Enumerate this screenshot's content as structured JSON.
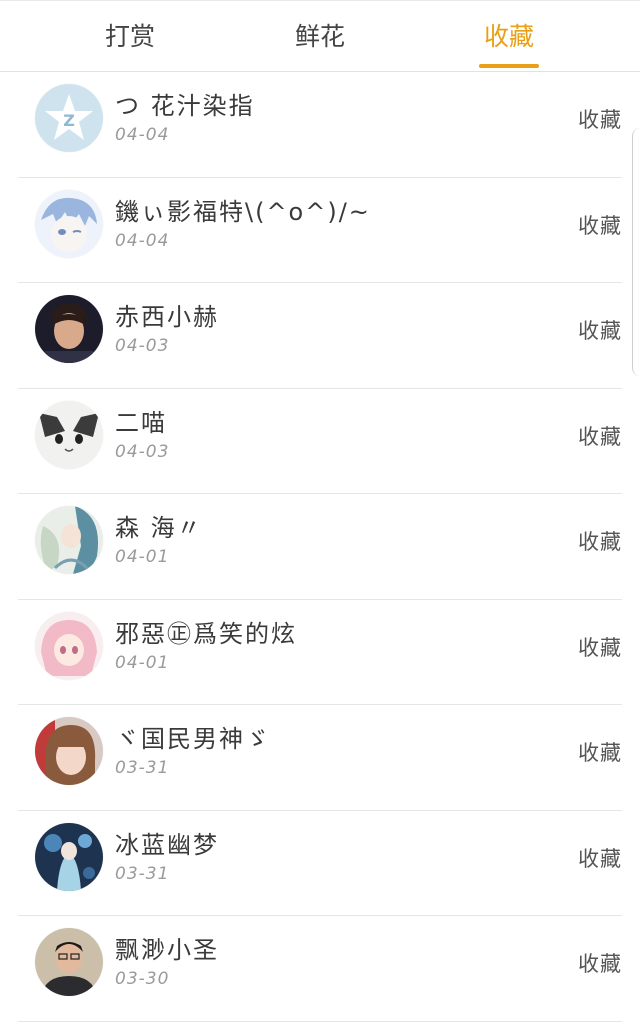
{
  "tabs": [
    {
      "label": "打赏",
      "active": false
    },
    {
      "label": "鲜花",
      "active": false
    },
    {
      "label": "收藏",
      "active": true
    }
  ],
  "accent_color": "#e8a018",
  "list": [
    {
      "name": "つ 花汁染指",
      "date": "04-04",
      "action": "收藏",
      "avatar": "qzone-star-avatar"
    },
    {
      "name": "鐖ぃ影福特\\(^o^)/~",
      "date": "04-04",
      "action": "收藏",
      "avatar": "anime-boy-avatar"
    },
    {
      "name": "赤西小赫",
      "date": "04-03",
      "action": "收藏",
      "avatar": "person-photo-avatar"
    },
    {
      "name": "二喵",
      "date": "04-03",
      "action": "收藏",
      "avatar": "cat-avatar"
    },
    {
      "name": "森 海〃",
      "date": "04-01",
      "action": "收藏",
      "avatar": "anime-girl-avatar"
    },
    {
      "name": "邪惡㊣爲笑的炫",
      "date": "04-01",
      "action": "收藏",
      "avatar": "pink-anime-avatar"
    },
    {
      "name": "ヾ国民男神ゞ",
      "date": "03-31",
      "action": "收藏",
      "avatar": "girl-photo-avatar"
    },
    {
      "name": "冰蓝幽梦",
      "date": "03-31",
      "action": "收藏",
      "avatar": "blue-art-avatar"
    },
    {
      "name": "飘渺小圣",
      "date": "03-30",
      "action": "收藏",
      "avatar": "man-photo-avatar"
    }
  ]
}
